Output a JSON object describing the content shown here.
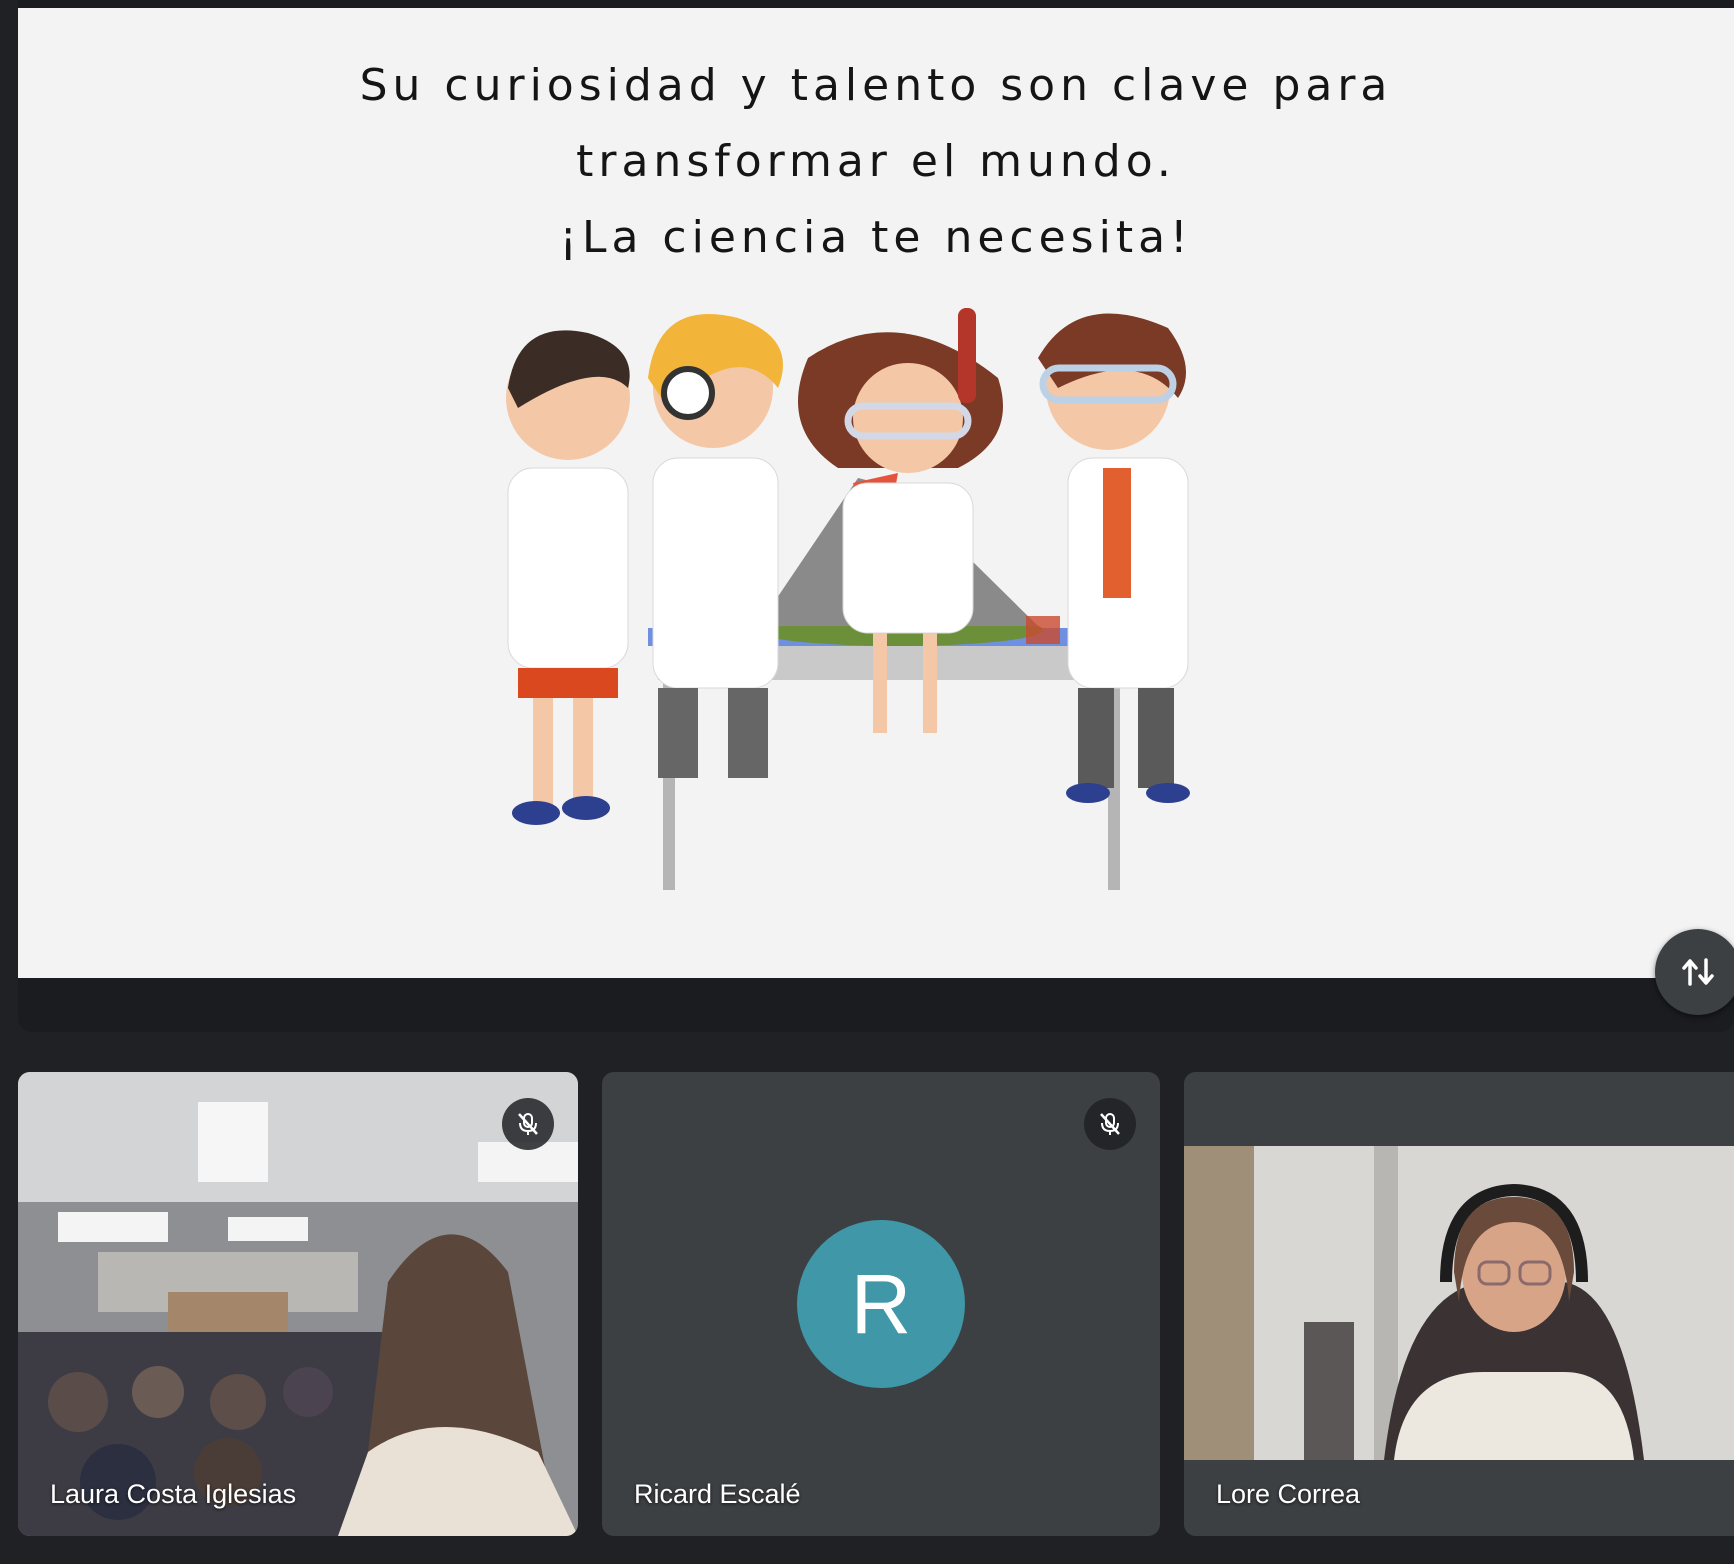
{
  "slide": {
    "lines": [
      "Su curiosidad y talento son clave para",
      "transformar el mundo.",
      "¡La ciencia te necesita!"
    ]
  },
  "controls": {
    "swap_icon": "swap-vert-icon"
  },
  "participants": [
    {
      "name": "Laura Costa Iglesias",
      "muted": true,
      "video": "classroom-camera"
    },
    {
      "name": "Ricard Escalé",
      "muted": true,
      "avatar_initial": "R",
      "avatar_color": "#3f97a8"
    },
    {
      "name": "Lore Correa",
      "muted": false,
      "video": "webcam"
    }
  ],
  "colors": {
    "background": "#202124",
    "tile": "#3c4043",
    "slide_bg": "#f3f3f3"
  }
}
